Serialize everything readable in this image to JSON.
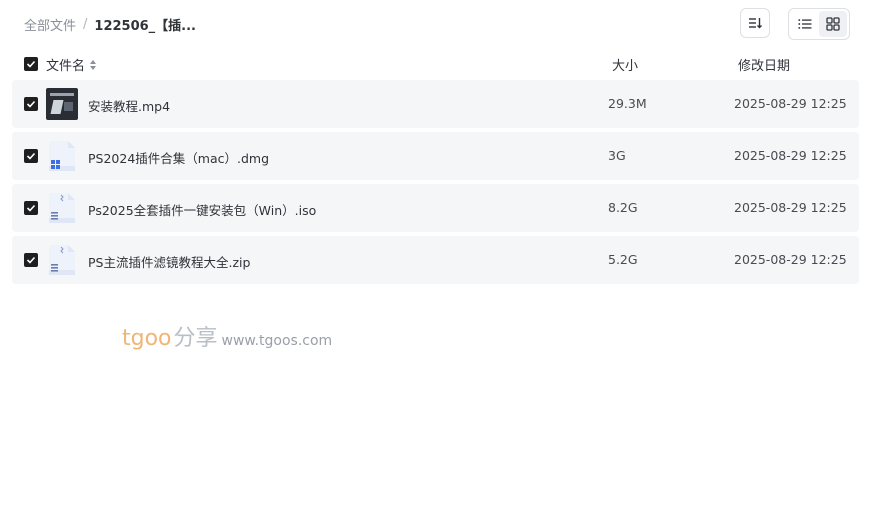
{
  "breadcrumb": {
    "root": "全部文件",
    "separator": "/",
    "current": "122506_【插..."
  },
  "toolbar": {
    "sort_icon": "sort-lines-icon",
    "list_view_icon": "list-view-icon",
    "grid_view_icon": "grid-view-icon",
    "active_view": "list"
  },
  "table": {
    "headers": {
      "name": "文件名",
      "size": "大小",
      "date": "修改日期"
    },
    "rows": [
      {
        "name": "安装教程.mp4",
        "size": "29.3M",
        "date": "2025-08-29 12:25",
        "icon": "video-thumbnail",
        "checked": true
      },
      {
        "name": "PS2024插件合集（mac）.dmg",
        "size": "3G",
        "date": "2025-08-29 12:25",
        "icon": "installer-file-icon",
        "checked": true
      },
      {
        "name": "Ps2025全套插件一键安装包（Win）.iso",
        "size": "8.2G",
        "date": "2025-08-29 12:25",
        "icon": "archive-file-icon",
        "checked": true
      },
      {
        "name": "PS主流插件滤镜教程大全.zip",
        "size": "5.2G",
        "date": "2025-08-29 12:25",
        "icon": "archive-file-icon",
        "checked": true
      }
    ]
  },
  "watermark": {
    "brand": "tgoo",
    "brand_cn": "分享",
    "url": "www.tgoos.com"
  },
  "colors": {
    "row_bg": "#f5f6f7",
    "checkbox": "#1f1f1f",
    "watermark_brand": "#f0b675"
  }
}
